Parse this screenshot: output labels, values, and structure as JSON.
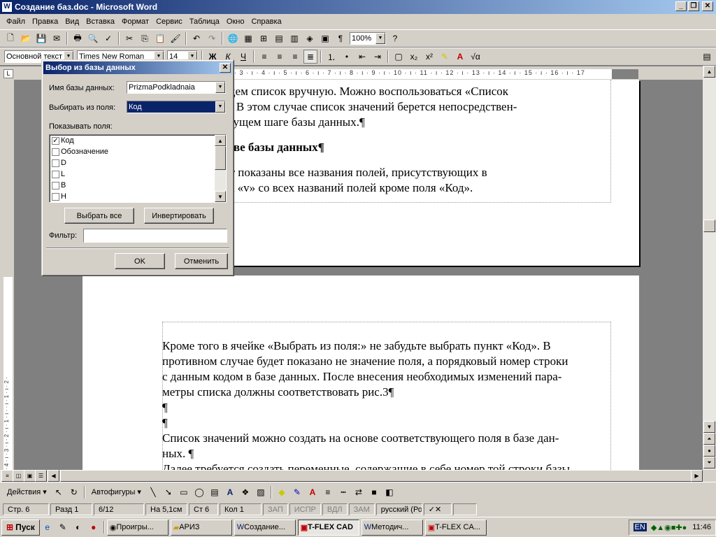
{
  "window": {
    "title": "Создание баз.doc - Microsoft Word",
    "min": "_",
    "max": "❐",
    "close": "✕"
  },
  "menu": [
    "Файл",
    "Правка",
    "Вид",
    "Вставка",
    "Формат",
    "Сервис",
    "Таблица",
    "Окно",
    "Справка"
  ],
  "toolbar": {
    "zoom": "100%",
    "style": "Основной текст",
    "font": "Times New Roman",
    "size": "14"
  },
  "doc_page1": [
    "...текст» и введем список вручную. Можно воспользоваться «Список",
    "базы данных». В этом случае список значений берется непосредствен-",
    "ной на предыдущем шаге базы данных.¶",
    "писка на основе базы данных¶",
    "мся окне будут показаны все названия полей, присутствующих в",
    ". Убираем знак «v» со всех названий полей кроме поля «Код»."
  ],
  "doc_page2": [
    "Кроме того в ячейке «Выбрать из поля:» не забудьте выбрать пункт «Код». В",
    "противном случае будет показано не значение поля, а порядковый номер строки",
    "с данным кодом в базе данных. После внесения необходимых изменений пара-",
    "метры списка должны соответствовать рис.3¶",
    "¶",
    "¶",
    "Список значений можно создать на основе соответствующего поля в базе дан-",
    "ных. ¶",
    "Далее требуется создать переменные, содержащие в себе номер той строки базы"
  ],
  "dialog": {
    "title": "Выбор из базы данных",
    "db_label": "Имя базы данных:",
    "db_value": "PrizmaPodkladnaia",
    "field_label": "Выбирать из поля:",
    "field_value": "Код",
    "show_label": "Показывать поля:",
    "fields": [
      {
        "name": "Код",
        "checked": true
      },
      {
        "name": "Обозначение",
        "checked": false
      },
      {
        "name": "D",
        "checked": false
      },
      {
        "name": "L",
        "checked": false
      },
      {
        "name": "B",
        "checked": false
      },
      {
        "name": "H",
        "checked": false
      }
    ],
    "select_all": "Выбрать все",
    "invert": "Инвертировать",
    "filter_label": "Фильтр:",
    "filter_value": "",
    "ok": "OK",
    "cancel": "Отменить"
  },
  "drawbar": {
    "actions": "Действия ▾",
    "autoshapes": "Автофигуры ▾"
  },
  "status": {
    "page": "Стр. 6",
    "section": "Разд 1",
    "pages": "6/12",
    "at": "На 5,1см",
    "line": "Ст 6",
    "col": "Кол 1",
    "rec": "ЗАП",
    "trk": "ИСПР",
    "ext": "ВДЛ",
    "ovr": "ЗАМ",
    "lang": "русский (Ро"
  },
  "taskbar": {
    "start": "Пуск",
    "tasks": [
      "Проигры...",
      "АРИЗ",
      "Создание...",
      "T-FLEX CAD",
      "Методич...",
      "T-FLEX CA..."
    ],
    "active": 2,
    "lang": "EN",
    "time": "11:46"
  }
}
